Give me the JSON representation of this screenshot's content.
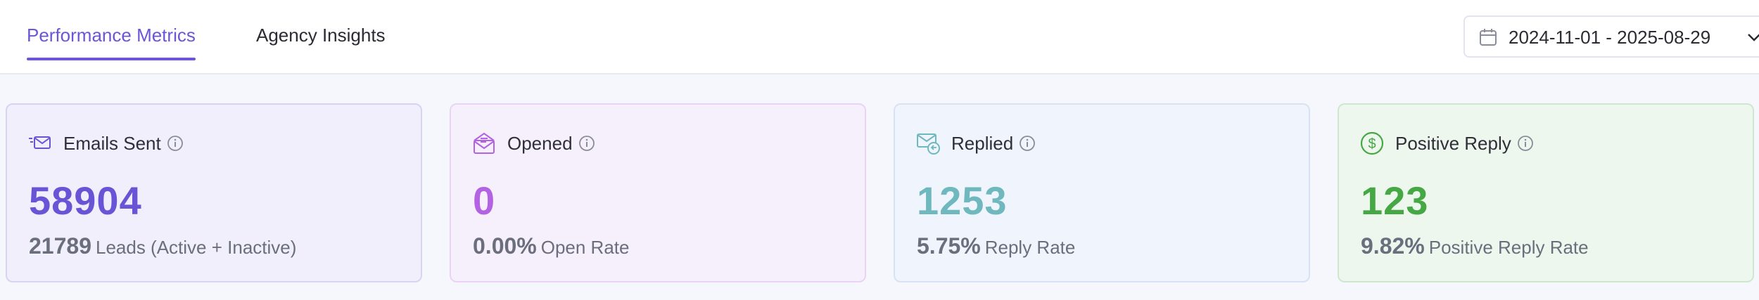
{
  "tabs": [
    {
      "label": "Performance Metrics",
      "active": true
    },
    {
      "label": "Agency Insights",
      "active": false
    }
  ],
  "date_range": {
    "label": "2024-11-01 - 2025-08-29",
    "icon": "calendar-icon"
  },
  "colors": {
    "accent": "#6d55d6",
    "emails_sent": "#6a54d6",
    "opened": "#b262e2",
    "replied": "#6fb9be",
    "positive_reply": "#45a845"
  },
  "cards": [
    {
      "title": "Emails Sent",
      "icon": "email-send-icon",
      "value": "58904",
      "sub_value": "21789",
      "sub_label": "Leads (Active + Inactive)"
    },
    {
      "title": "Opened",
      "icon": "envelope-open-icon",
      "value": "0",
      "sub_value": "0.00%",
      "sub_label": "Open Rate"
    },
    {
      "title": "Replied",
      "icon": "email-reply-icon",
      "value": "1253",
      "sub_value": "5.75%",
      "sub_label": "Reply Rate"
    },
    {
      "title": "Positive Reply",
      "icon": "dollar-circle-icon",
      "value": "123",
      "sub_value": "9.82%",
      "sub_label": "Positive Reply Rate"
    }
  ]
}
